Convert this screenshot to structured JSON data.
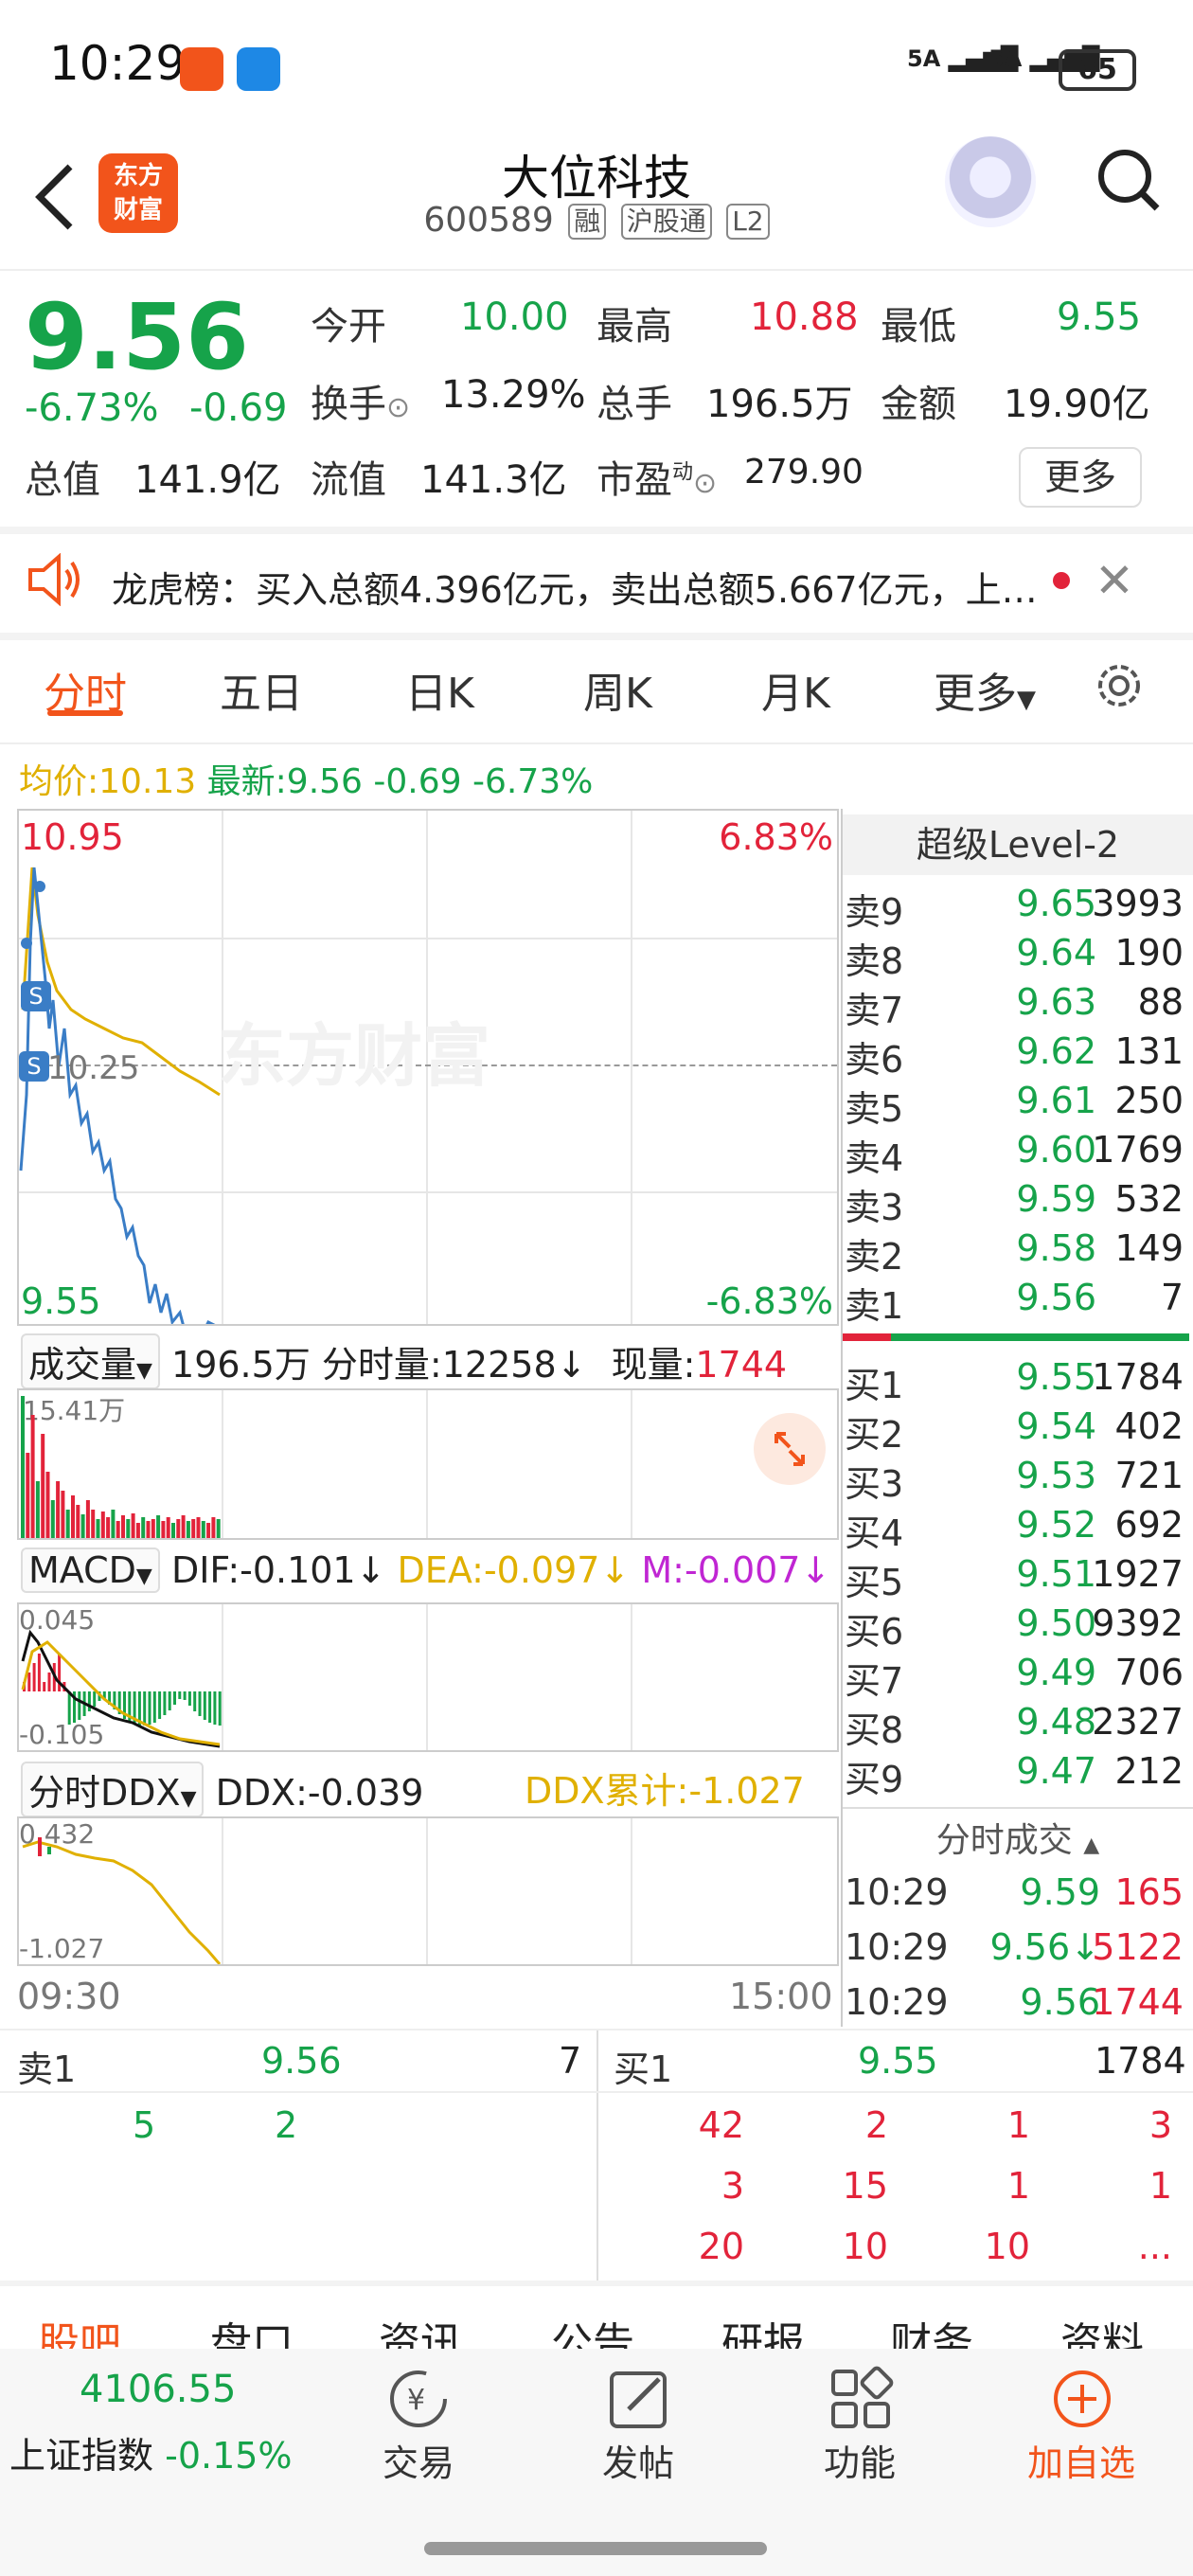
{
  "status_bar": {
    "time": "10:29",
    "battery": "65",
    "signal_1": "5A",
    "signal_2": "5A"
  },
  "header": {
    "logo_text": "东方财富",
    "stock_name": "大位科技",
    "stock_code": "600589",
    "tags": [
      "融",
      "沪股通",
      "L2"
    ]
  },
  "quote": {
    "price": "9.56",
    "change_pct": "-6.73%",
    "change": "-0.69",
    "open_label": "今开",
    "open": "10.00",
    "high_label": "最高",
    "high": "10.88",
    "low_label": "最低",
    "low": "9.55",
    "turnover_label": "换手",
    "turnover": "13.29%",
    "volume_label": "总手",
    "volume": "196.5万",
    "amount_label": "金额",
    "amount": "19.90亿",
    "mcap_label": "总值",
    "mcap": "141.9亿",
    "float_label": "流值",
    "float_cap": "141.3亿",
    "pe_label": "市盈",
    "pe_sup": "动",
    "pe": "279.90",
    "more": "更多"
  },
  "notice": {
    "text": "龙虎榜：买入总额4.396亿元，卖出总额5.667亿元，上…"
  },
  "tabs": [
    "分时",
    "五日",
    "日K",
    "周K",
    "月K",
    "更多"
  ],
  "avg_line": {
    "avg_label": "均价:",
    "avg": "10.13",
    "latest_label": "最新:",
    "latest": "9.56 -0.69 -6.73%"
  },
  "chart": {
    "top_price": "10.95",
    "top_pct": "6.83%",
    "mid_price": "10.25",
    "bottom_price": "9.55",
    "bottom_pct": "-6.83%",
    "watermark": "东方财富",
    "time_start": "09:30",
    "time_end": "15:00"
  },
  "volume_panel": {
    "label": "成交量",
    "total": "196.5万",
    "tick_label": "分时量:",
    "tick": "12258↓",
    "now_label": "现量:",
    "now": "1744",
    "max": "15.41万"
  },
  "macd_panel": {
    "label": "MACD",
    "dif": "DIF:-0.101↓",
    "dea": "DEA:-0.097↓",
    "m": "M:-0.007↓",
    "top": "0.045",
    "bottom": "-0.105"
  },
  "ddx_panel": {
    "label": "分时DDX",
    "ddx": "DDX:-0.039",
    "cum": "DDX累计:-1.027",
    "top": "0.432",
    "bottom": "-1.027"
  },
  "order_book": {
    "title": "超级Level-2",
    "asks": [
      {
        "name": "卖9",
        "price": "9.65",
        "vol": "3993"
      },
      {
        "name": "卖8",
        "price": "9.64",
        "vol": "190"
      },
      {
        "name": "卖7",
        "price": "9.63",
        "vol": "88"
      },
      {
        "name": "卖6",
        "price": "9.62",
        "vol": "131"
      },
      {
        "name": "卖5",
        "price": "9.61",
        "vol": "250"
      },
      {
        "name": "卖4",
        "price": "9.60",
        "vol": "1769"
      },
      {
        "name": "卖3",
        "price": "9.59",
        "vol": "532"
      },
      {
        "name": "卖2",
        "price": "9.58",
        "vol": "149"
      },
      {
        "name": "卖1",
        "price": "9.56",
        "vol": "7"
      }
    ],
    "bids": [
      {
        "name": "买1",
        "price": "9.55",
        "vol": "1784"
      },
      {
        "name": "买2",
        "price": "9.54",
        "vol": "402"
      },
      {
        "name": "买3",
        "price": "9.53",
        "vol": "721"
      },
      {
        "name": "买4",
        "price": "9.52",
        "vol": "692"
      },
      {
        "name": "买5",
        "price": "9.51",
        "vol": "1927"
      },
      {
        "name": "买6",
        "price": "9.50",
        "vol": "9392"
      },
      {
        "name": "买7",
        "price": "9.49",
        "vol": "706"
      },
      {
        "name": "买8",
        "price": "9.48",
        "vol": "2327"
      },
      {
        "name": "买9",
        "price": "9.47",
        "vol": "212"
      }
    ]
  },
  "trades": {
    "title": "分时成交",
    "rows": [
      {
        "time": "10:29",
        "price": "9.59",
        "vol": "165"
      },
      {
        "time": "10:29",
        "price": "9.56↓",
        "vol": "5122"
      },
      {
        "time": "10:29",
        "price": "9.56",
        "vol": "1744"
      }
    ]
  },
  "queue": {
    "ask_label": "卖1",
    "ask_price": "9.56",
    "ask_vol": "7",
    "bid_label": "买1",
    "bid_price": "9.55",
    "bid_vol": "1784",
    "ask_orders": [
      "5",
      "2"
    ],
    "bid_orders": [
      [
        "42",
        "2",
        "1",
        "3"
      ],
      [
        "3",
        "15",
        "1",
        "1"
      ],
      [
        "20",
        "10",
        "10",
        "..."
      ]
    ]
  },
  "bottom_tabs": [
    "股吧",
    "盘口",
    "资讯",
    "公告",
    "研报",
    "财务",
    "资料"
  ],
  "toolbar": {
    "index_value": "4106.55",
    "index_name": "上证指数",
    "index_chg": "-0.15%",
    "items": [
      "交易",
      "发帖",
      "功能",
      "加自选"
    ]
  }
}
